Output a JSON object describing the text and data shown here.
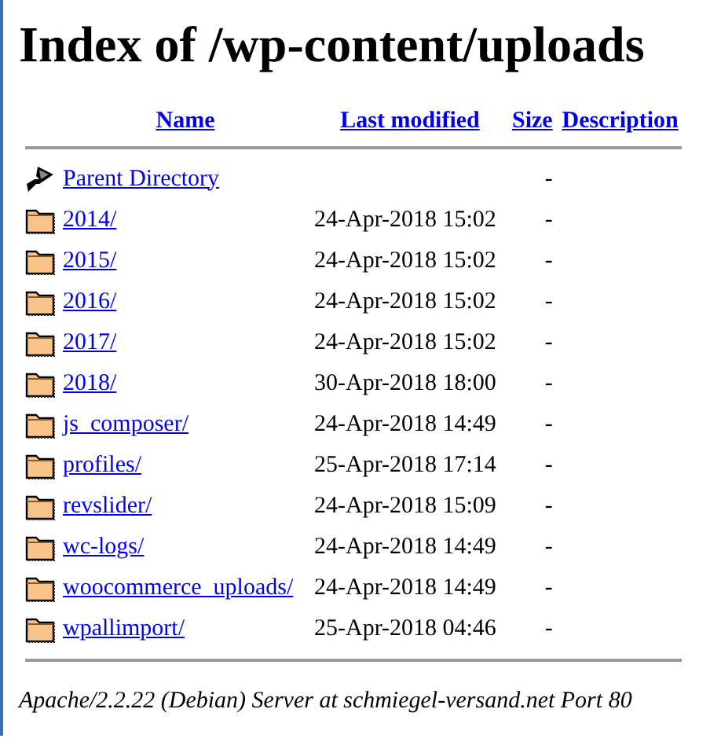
{
  "title": "Index of /wp-content/uploads",
  "columns": [
    "Name",
    "Last modified",
    "Size",
    "Description"
  ],
  "rows": [
    {
      "kind": "parent",
      "name": "Parent Directory",
      "size": "-"
    },
    {
      "kind": "folder",
      "name": "2014/",
      "modified": "24-Apr-2018 15:02",
      "size": "-"
    },
    {
      "kind": "folder",
      "name": "2015/",
      "modified": "24-Apr-2018 15:02",
      "size": "-"
    },
    {
      "kind": "folder",
      "name": "2016/",
      "modified": "24-Apr-2018 15:02",
      "size": "-"
    },
    {
      "kind": "folder",
      "name": "2017/",
      "modified": "24-Apr-2018 15:02",
      "size": "-"
    },
    {
      "kind": "folder",
      "name": "2018/",
      "modified": "30-Apr-2018 18:00",
      "size": "-"
    },
    {
      "kind": "folder",
      "name": "js_composer/",
      "modified": "24-Apr-2018 14:49",
      "size": "-"
    },
    {
      "kind": "folder",
      "name": "profiles/",
      "modified": "25-Apr-2018 17:14",
      "size": "-"
    },
    {
      "kind": "folder",
      "name": "revslider/",
      "modified": "24-Apr-2018 15:09",
      "size": "-"
    },
    {
      "kind": "folder",
      "name": "wc-logs/",
      "modified": "24-Apr-2018 14:49",
      "size": "-"
    },
    {
      "kind": "folder",
      "name": "woocommerce_uploads/",
      "modified": "24-Apr-2018 14:49",
      "size": "-"
    },
    {
      "kind": "folder",
      "name": "wpallimport/",
      "modified": "25-Apr-2018 04:46",
      "size": "-"
    }
  ],
  "footer": "Apache/2.2.22 (Debian) Server at schmiegel-versand.net Port 80"
}
